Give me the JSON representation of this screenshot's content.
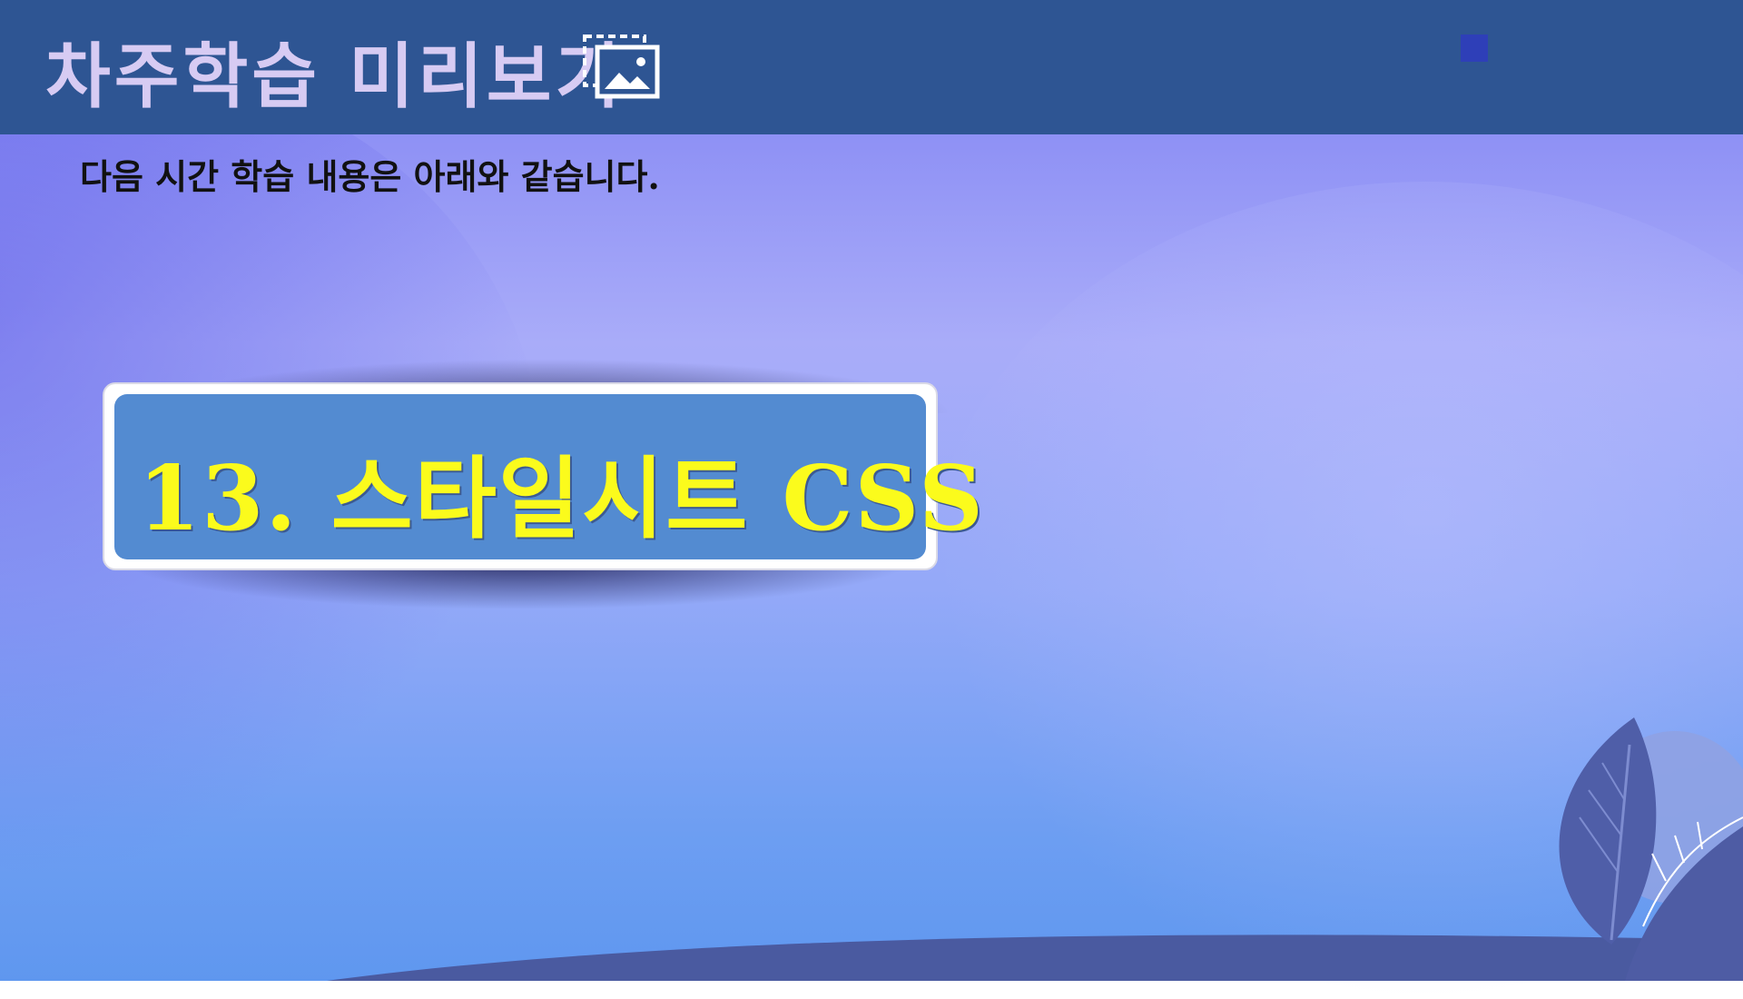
{
  "header": {
    "title": "차주학습 미리보기",
    "icon": "image-preview-icon"
  },
  "subtitle": "다음 시간 학습 내용은 아래와 같습니다.",
  "card": {
    "title": "13. 스타일시트 CSS"
  },
  "colors": {
    "header_bg": "#2e5593",
    "header_text": "#d7cbf3",
    "card_bg": "#538bd1",
    "card_text": "#fbfb1c",
    "footer_wave": "#4a5aa0"
  },
  "decorations": {
    "corner_square": "small-blue-square",
    "footer": "leaf-illustration"
  }
}
